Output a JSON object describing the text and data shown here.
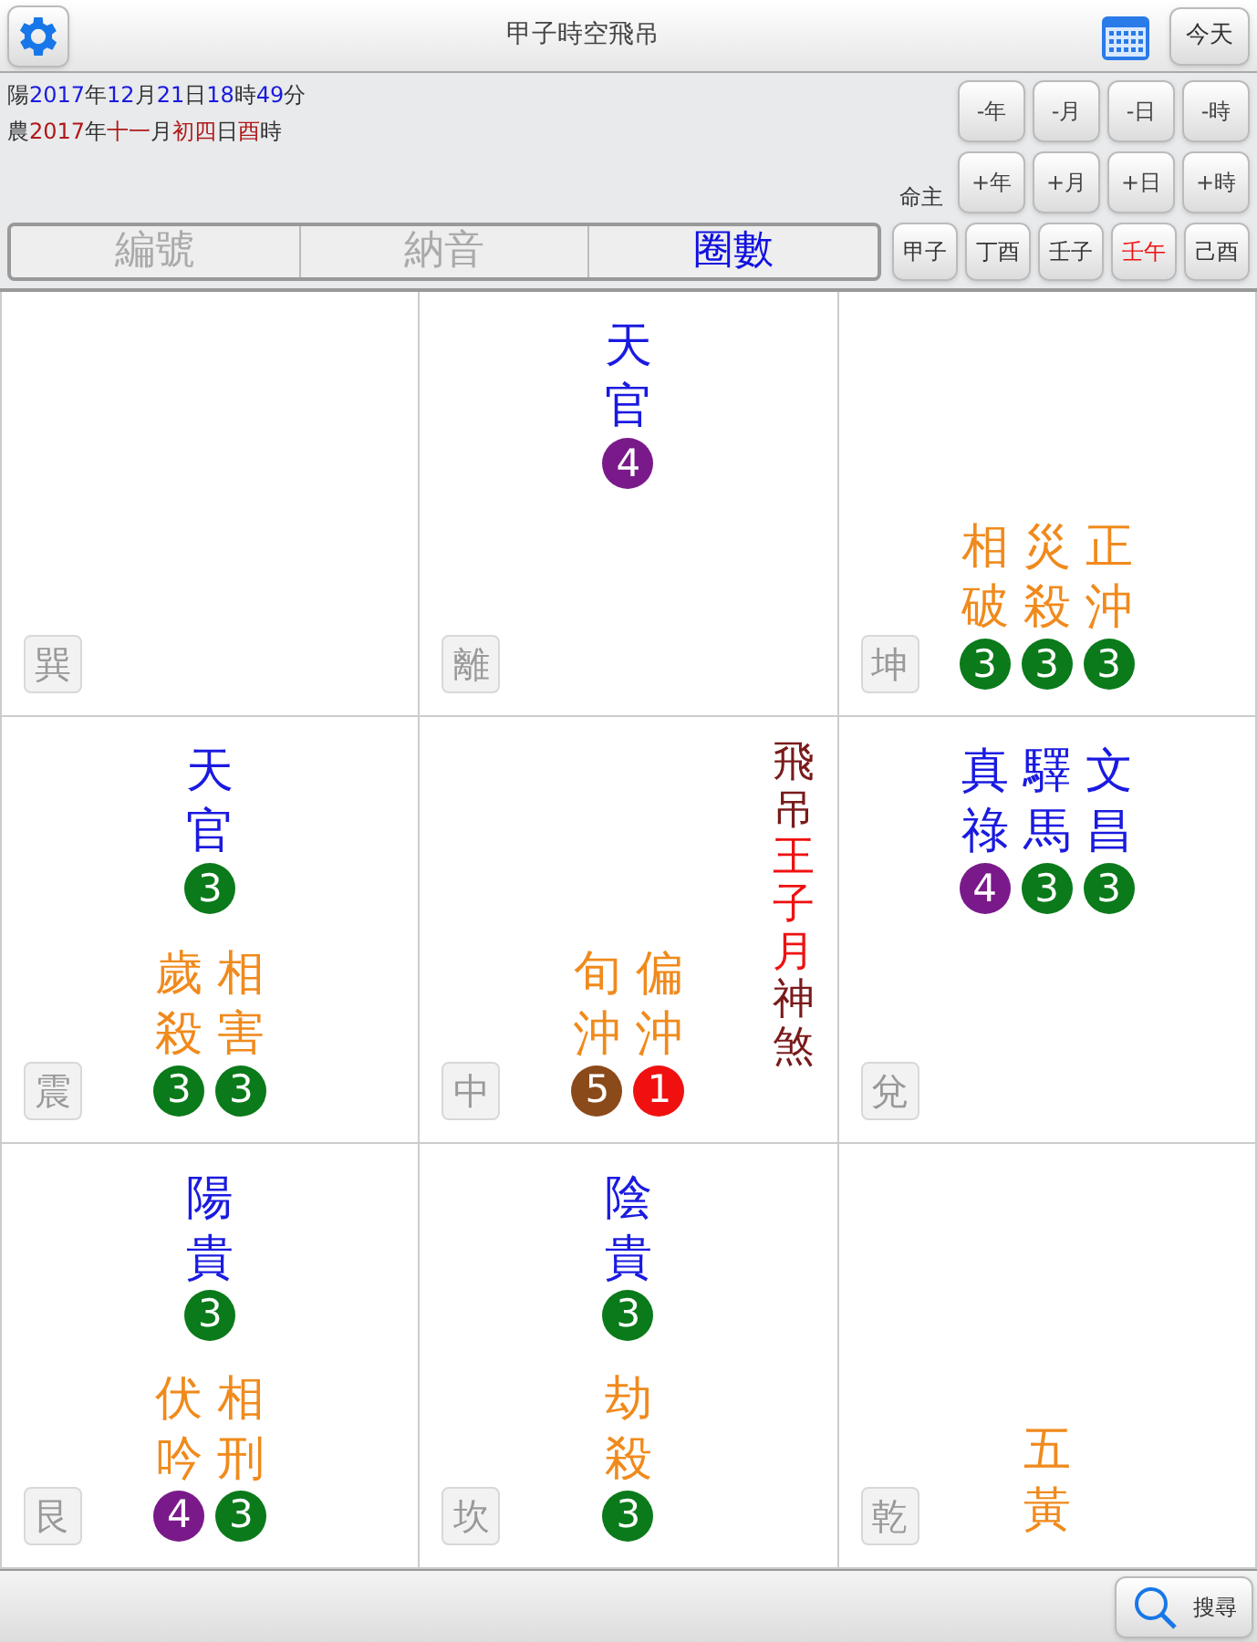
{
  "title": "甲子時空飛吊",
  "today_button": "今天",
  "date_lines": [
    [
      {
        "text": "陽",
        "color": "#333333"
      },
      {
        "text": "2017",
        "color": "#1a1ae0"
      },
      {
        "text": "年",
        "color": "#333333"
      },
      {
        "text": "12",
        "color": "#1a1ae0"
      },
      {
        "text": "月",
        "color": "#333333"
      },
      {
        "text": "21",
        "color": "#1a1ae0"
      },
      {
        "text": "日",
        "color": "#333333"
      },
      {
        "text": "18",
        "color": "#1a1ae0"
      },
      {
        "text": "時",
        "color": "#333333"
      },
      {
        "text": "49",
        "color": "#1a1ae0"
      },
      {
        "text": "分",
        "color": "#333333"
      }
    ],
    [
      {
        "text": "農",
        "color": "#333333"
      },
      {
        "text": "2017",
        "color": "#b01818"
      },
      {
        "text": "年",
        "color": "#333333"
      },
      {
        "text": "十一",
        "color": "#b01818"
      },
      {
        "text": "月",
        "color": "#333333"
      },
      {
        "text": "初四",
        "color": "#b01818"
      },
      {
        "text": "日",
        "color": "#333333"
      },
      {
        "text": "酉",
        "color": "#b01818"
      },
      {
        "text": "時",
        "color": "#333333"
      }
    ]
  ],
  "step_buttons": [
    [
      "-年",
      "-月",
      "-日",
      "-時"
    ],
    [
      "+年",
      "+月",
      "+日",
      "+時"
    ]
  ],
  "owner_label": "命主",
  "tabs": [
    {
      "label": "編號",
      "selected": false
    },
    {
      "label": "納音",
      "selected": false
    },
    {
      "label": "圈數",
      "selected": true
    }
  ],
  "pillars": [
    {
      "label": "甲子",
      "selected": false
    },
    {
      "label": "丁酉",
      "selected": false
    },
    {
      "label": "壬子",
      "selected": false
    },
    {
      "label": "壬午",
      "selected": true
    },
    {
      "label": "己酉",
      "selected": false
    }
  ],
  "palaces": [
    {
      "label": "巽"
    },
    {
      "label": "離",
      "groups": [
        {
          "kind": "upper",
          "color": "#1a1ae0",
          "stars": [
            {
              "name": "天官",
              "count": "4",
              "color": "#7a1a8a"
            }
          ]
        }
      ]
    },
    {
      "label": "坤",
      "groups": [
        {
          "kind": "lower",
          "color": "#f08a1c",
          "stars": [
            {
              "name": "相破",
              "count": "3",
              "color": "#0a7a1a"
            },
            {
              "name": "災殺",
              "count": "3",
              "color": "#0a7a1a"
            },
            {
              "name": "正沖",
              "count": "3",
              "color": "#0a7a1a"
            }
          ]
        }
      ]
    },
    {
      "label": "震",
      "groups": [
        {
          "kind": "upper",
          "color": "#1a1ae0",
          "stars": [
            {
              "name": "天官",
              "count": "3",
              "color": "#0a7a1a"
            }
          ]
        },
        {
          "kind": "lower",
          "color": "#f08a1c",
          "stars": [
            {
              "name": "歲殺",
              "count": "3",
              "color": "#0a7a1a"
            },
            {
              "name": "相害",
              "count": "3",
              "color": "#0a7a1a"
            }
          ]
        }
      ]
    },
    {
      "label": "中",
      "groups": [
        {
          "kind": "lower",
          "color": "#f08a1c",
          "stars": [
            {
              "name": "旬沖",
              "count": "5",
              "color": "#8a4a1a"
            },
            {
              "name": "偏沖",
              "count": "1",
              "color": "#f01010"
            }
          ]
        }
      ],
      "side_text": [
        {
          "text": "飛吊",
          "color": "#7a1a1a"
        },
        {
          "text": "王子月",
          "color": "#f01010"
        },
        {
          "text": "神煞",
          "color": "#7a1a1a"
        }
      ]
    },
    {
      "label": "兌",
      "groups": [
        {
          "kind": "upper",
          "color": "#1a1ae0",
          "stars": [
            {
              "name": "真祿",
              "count": "4",
              "color": "#7a1a8a"
            },
            {
              "name": "驛馬",
              "count": "3",
              "color": "#0a7a1a"
            },
            {
              "name": "文昌",
              "count": "3",
              "color": "#0a7a1a"
            }
          ]
        }
      ]
    },
    {
      "label": "艮",
      "groups": [
        {
          "kind": "upper",
          "color": "#1a1ae0",
          "stars": [
            {
              "name": "陽貴",
              "count": "3",
              "color": "#0a7a1a"
            }
          ]
        },
        {
          "kind": "lower",
          "color": "#f08a1c",
          "stars": [
            {
              "name": "伏吟",
              "count": "4",
              "color": "#7a1a8a"
            },
            {
              "name": "相刑",
              "count": "3",
              "color": "#0a7a1a"
            }
          ]
        }
      ]
    },
    {
      "label": "坎",
      "groups": [
        {
          "kind": "upper",
          "color": "#1a1ae0",
          "stars": [
            {
              "name": "陰貴",
              "count": "3",
              "color": "#0a7a1a"
            }
          ]
        },
        {
          "kind": "lower",
          "color": "#f08a1c",
          "stars": [
            {
              "name": "劫殺",
              "count": "3",
              "color": "#0a7a1a"
            }
          ]
        }
      ]
    },
    {
      "label": "乾",
      "groups": [
        {
          "kind": "lower",
          "color": "#f08a1c",
          "stars": [
            {
              "name": "五黃"
            }
          ]
        }
      ]
    }
  ],
  "search_button": "搜尋"
}
